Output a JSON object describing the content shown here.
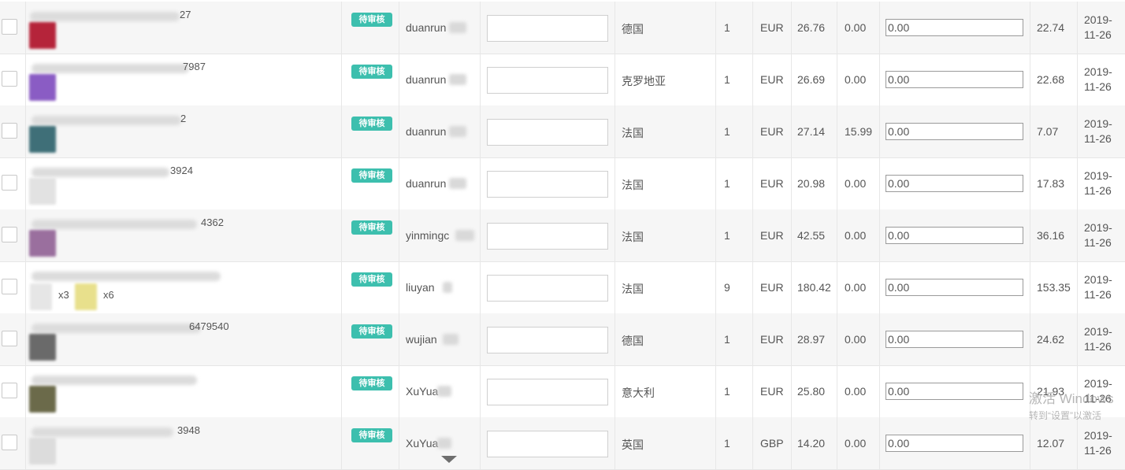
{
  "rows": [
    {
      "sku_tail": "27",
      "thumbs": [
        {
          "color": "#b5243a"
        }
      ],
      "badge": "待审核",
      "user": "duanrun",
      "country": "德国",
      "qty": "1",
      "currency": "EUR",
      "price": "26.76",
      "shipping": "0.00",
      "fee": "0.00",
      "profit": "22.74",
      "date": [
        "2019-",
        "11-26"
      ]
    },
    {
      "sku_tail": "7987",
      "thumbs": [
        {
          "color": "#8a5cc4"
        }
      ],
      "badge": "待审核",
      "user": "duanrun",
      "country": "克罗地亚",
      "qty": "1",
      "currency": "EUR",
      "price": "26.69",
      "shipping": "0.00",
      "fee": "0.00",
      "profit": "22.68",
      "date": [
        "2019-",
        "11-26"
      ]
    },
    {
      "sku_tail": "2",
      "thumbs": [
        {
          "color": "#3f6f78"
        }
      ],
      "badge": "待审核",
      "user": "duanrun",
      "country": "法国",
      "qty": "1",
      "currency": "EUR",
      "price": "27.14",
      "shipping": "15.99",
      "fee": "0.00",
      "profit": "7.07",
      "date": [
        "2019-",
        "11-26"
      ]
    },
    {
      "sku_tail": "3924",
      "thumbs": [
        {
          "color": "#e2e2e2"
        }
      ],
      "badge": "待审核",
      "user": "duanrun",
      "country": "法国",
      "qty": "1",
      "currency": "EUR",
      "price": "20.98",
      "shipping": "0.00",
      "fee": "0.00",
      "profit": "17.83",
      "date": [
        "2019-",
        "11-26"
      ]
    },
    {
      "sku_tail": "4362",
      "thumbs": [
        {
          "color": "#9a6f9e"
        }
      ],
      "badge": "待审核",
      "user": "yinmingc",
      "country": "法国",
      "qty": "1",
      "currency": "EUR",
      "price": "42.55",
      "shipping": "0.00",
      "fee": "0.00",
      "profit": "36.16",
      "date": [
        "2019-",
        "11-26"
      ]
    },
    {
      "sku_tail": "",
      "thumbs": [
        {
          "color": "#e6e6e6",
          "qty": "x3"
        },
        {
          "color": "#e8e08c",
          "qty": "x6"
        }
      ],
      "badge": "待审核",
      "user": "liuyan",
      "country": "法国",
      "qty": "9",
      "currency": "EUR",
      "price": "180.42",
      "shipping": "0.00",
      "fee": "0.00",
      "profit": "153.35",
      "date": [
        "2019-",
        "11-26"
      ]
    },
    {
      "sku_tail": "6479540",
      "thumbs": [
        {
          "color": "#6a6a6a"
        }
      ],
      "badge": "待审核",
      "user": "wujian",
      "country": "德国",
      "qty": "1",
      "currency": "EUR",
      "price": "28.97",
      "shipping": "0.00",
      "fee": "0.00",
      "profit": "24.62",
      "date": [
        "2019-",
        "11-26"
      ]
    },
    {
      "sku_tail": "",
      "thumbs": [
        {
          "color": "#6b6a4a"
        }
      ],
      "badge": "待审核",
      "user": "XuYua",
      "country": "意大利",
      "qty": "1",
      "currency": "EUR",
      "price": "25.80",
      "shipping": "0.00",
      "fee": "0.00",
      "profit": "21.93",
      "date": [
        "2019-",
        "11-26"
      ]
    },
    {
      "sku_tail": "3948",
      "thumbs": [
        {
          "color": "#dcdcdc"
        }
      ],
      "badge": "待审核",
      "user": "XuYua",
      "country": "英国",
      "qty": "1",
      "currency": "GBP",
      "price": "14.20",
      "shipping": "0.00",
      "fee": "0.00",
      "profit": "12.07",
      "date": [
        "2019-",
        "11-26"
      ]
    }
  ],
  "watermark": {
    "line1": "激活 Windows",
    "line2": "转到“设置”以激活"
  },
  "colors": {
    "badge": "#3dbfae",
    "row_alt": "#f6f6f6",
    "border": "#e6e6e6"
  }
}
